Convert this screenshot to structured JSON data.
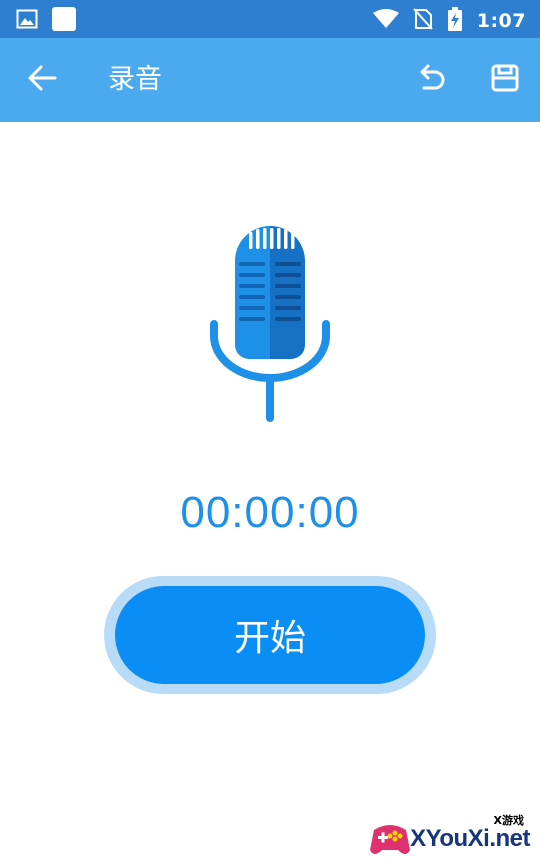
{
  "status_bar": {
    "time": "1:07",
    "icons": [
      "gallery-icon",
      "app-square-icon",
      "wifi-icon",
      "no-sim-icon",
      "battery-charging-icon"
    ]
  },
  "app_bar": {
    "title": "录音",
    "back_icon": "arrow-left-icon",
    "undo_icon": "undo-icon",
    "save_icon": "save-icon",
    "color": "#4aa9ef"
  },
  "recorder": {
    "mic_icon": "microphone-icon",
    "timer": "00:00:00",
    "start_label": "开始",
    "accent_color": "#0a8ef5"
  },
  "watermark": {
    "small_text": "X游戏",
    "text": "XYouXi.net"
  }
}
